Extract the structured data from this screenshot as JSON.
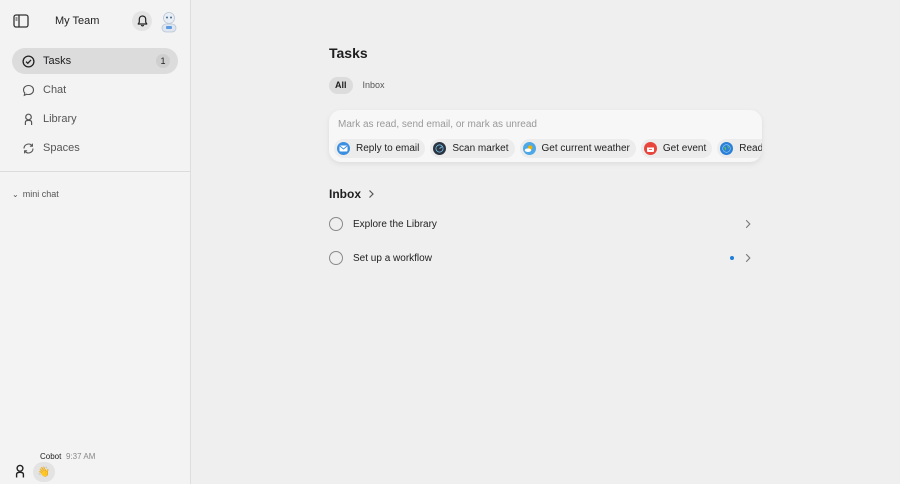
{
  "sidebar": {
    "team_name": "My Team",
    "nav": [
      {
        "label": "Tasks",
        "count": "1"
      },
      {
        "label": "Chat"
      },
      {
        "label": "Library"
      },
      {
        "label": "Spaces"
      }
    ],
    "mini_chat": "mini chat",
    "chat_preview": {
      "sender": "Cobot",
      "time": "9:37 AM",
      "emoji": "👋"
    }
  },
  "main": {
    "title": "Tasks",
    "tabs": [
      "All",
      "Inbox"
    ],
    "command": {
      "placeholder": "Mark as read, send email, or mark as unread",
      "chips": [
        {
          "label": "Reply to email",
          "icon": "mail-icon",
          "color": "#3a8fe0"
        },
        {
          "label": "Scan market",
          "icon": "radar-icon",
          "color": "#2b3440"
        },
        {
          "label": "Get current weather",
          "icon": "weather-icon",
          "color": "#f0b400"
        },
        {
          "label": "Get event",
          "icon": "calendar-icon",
          "color": "#e8463c"
        },
        {
          "label": "Read web page",
          "icon": "globe-icon",
          "color": "#2a7fd6"
        }
      ]
    },
    "inbox": {
      "title": "Inbox",
      "items": [
        {
          "label": "Explore the Library",
          "unread": false
        },
        {
          "label": "Set up a workflow",
          "unread": true
        }
      ]
    }
  },
  "colors": {
    "unread_dot": "#1e7fd8",
    "sidebar_bg": "#f3f3f3",
    "main_bg": "#efefef"
  }
}
